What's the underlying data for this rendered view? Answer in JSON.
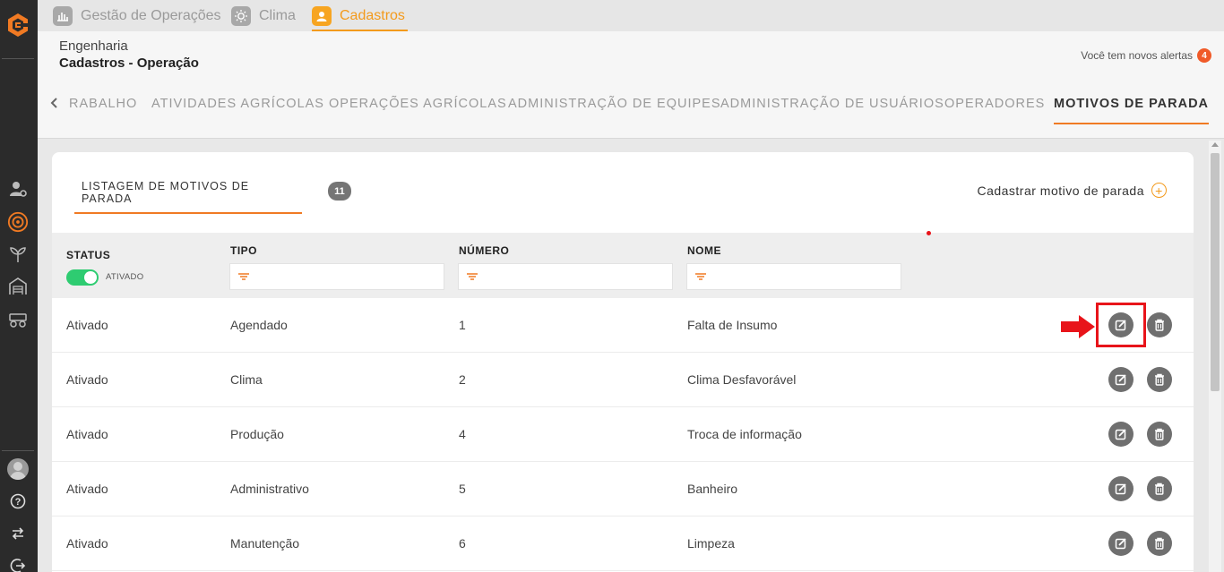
{
  "sidebar": {
    "icons": [
      "company-logo-icon",
      "user-settings-icon",
      "target-icon",
      "plant-icon",
      "warehouse-icon",
      "harvester-icon",
      "avatar",
      "help-icon",
      "swap-icon",
      "logout-icon"
    ]
  },
  "modules": {
    "items": [
      {
        "label": "Gestão de Operações",
        "icon": "operations-icon"
      },
      {
        "label": "Clima",
        "icon": "sun-icon"
      },
      {
        "label": "Cadastros",
        "icon": "user-card-icon",
        "active": true
      }
    ]
  },
  "header": {
    "breadcrumb_top": "Engenharia",
    "breadcrumb_title": "Cadastros - Operação",
    "alerts_text": "Você tem novos alertas",
    "alerts_count": "4"
  },
  "subtabs": {
    "items": [
      "RABALHO",
      "ATIVIDADES AGRÍCOLAS",
      "OPERAÇÕES AGRÍCOLAS",
      "ADMINISTRAÇÃO DE EQUIPES",
      "ADMINISTRAÇÃO DE USUÁRIOS",
      "OPERADORES",
      "MOTIVOS DE PARADA"
    ],
    "active_index": 6
  },
  "listing": {
    "tab_label": "LISTAGEM DE MOTIVOS DE PARADA",
    "count": "11",
    "register_label": "Cadastrar motivo de parada"
  },
  "columns": {
    "status": "STATUS",
    "status_toggle_label": "ATIVADO",
    "tipo": "TIPO",
    "numero": "NÚMERO",
    "nome": "NOME"
  },
  "rows": [
    {
      "status": "Ativado",
      "tipo": "Agendado",
      "numero": "1",
      "nome": "Falta de Insumo"
    },
    {
      "status": "Ativado",
      "tipo": "Clima",
      "numero": "2",
      "nome": "Clima Desfavorável"
    },
    {
      "status": "Ativado",
      "tipo": "Produção",
      "numero": "4",
      "nome": "Troca de informação"
    },
    {
      "status": "Ativado",
      "tipo": "Administrativo",
      "numero": "5",
      "nome": "Banheiro"
    },
    {
      "status": "Ativado",
      "tipo": "Manutenção",
      "numero": "6",
      "nome": "Limpeza"
    }
  ],
  "colors": {
    "accent_orange": "#f07a23",
    "module_active": "#f39a1c",
    "toggle_on": "#2ecc71",
    "sidebar_bg": "#2b2b2b",
    "annotation_red": "#e8141a"
  }
}
